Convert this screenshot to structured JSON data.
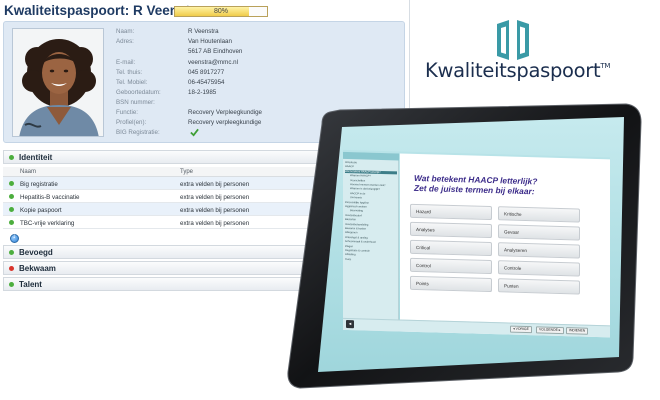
{
  "profile": {
    "title": "Kwaliteitspaspoort: R Veenstra",
    "progress_label": "80%",
    "progress_value": 0.8,
    "fields": [
      {
        "label": "Naam:",
        "value": "R Veenstra"
      },
      {
        "label": "Adres:",
        "value": "Van Houtenlaan"
      },
      {
        "label": "",
        "value": "5617 AB Eindhoven"
      },
      {
        "label": "E-mail:",
        "value": "veenstra@mmc.nl"
      },
      {
        "label": "Tel. thuis:",
        "value": "045 8917277"
      },
      {
        "label": "Tel. Mobiel:",
        "value": "06-45475954"
      },
      {
        "label": "Geboortedatum:",
        "value": "18-2-1985"
      },
      {
        "label": "BSN nummer:",
        "value": ""
      },
      {
        "label": "Functie:",
        "value": "Recovery Verpleegkundige"
      },
      {
        "label": "Profiel(en):",
        "value": "Recovery verpleegkundige"
      },
      {
        "label": "BIG Registratie:",
        "value": ""
      }
    ],
    "big_check_icon": "check-icon",
    "sections": {
      "identiteit": "Identiteit",
      "bevoegd": "Bevoegd",
      "bekwaam": "Bekwaam",
      "talent": "Talent"
    },
    "table": {
      "headers": [
        "Naam",
        "Type"
      ],
      "rows": [
        {
          "name": "Big registratie",
          "type": "extra velden bij personen"
        },
        {
          "name": "Hepatitis-B vaccinatie",
          "type": "extra velden bij personen"
        },
        {
          "name": "Kopie paspoort",
          "type": "extra velden bij personen"
        },
        {
          "name": "TBC-vrije verklaring",
          "type": "extra velden bij personen"
        }
      ]
    },
    "colors": {
      "green": "#4cae3e",
      "red": "#d9342b",
      "title": "#1f3b63"
    }
  },
  "logo": {
    "text": "Kwaliteitspaspoort",
    "tm": "TM",
    "color": "#1b2e4e",
    "accent": "#3a9aa6"
  },
  "tablet": {
    "topbar_left": "HAACP",
    "topbar_right": "Voortgang",
    "sidebar_items": [
      {
        "label": "Introductie"
      },
      {
        "label": "HAACP"
      },
      {
        "label": "Wat betekent HAACP letterlijk?",
        "active": true
      },
      {
        "label": "Waarom HAACP?",
        "sub": true
      },
      {
        "label": "Voorschriften",
        "sub": true
      },
      {
        "label": "Hoeveel mensen werden ziek?",
        "sub": true
      },
      {
        "label": "Waarom is dat belangrijk?",
        "sub": true
      },
      {
        "label": "HACCP in de",
        "sub": true
      },
      {
        "label": "Uw kennis",
        "sub": true
      },
      {
        "label": "Persoonlijke hygiëne"
      },
      {
        "label": "Hygiënisch werken"
      },
      {
        "label": "Besmetting",
        "sub": true
      },
      {
        "label": "Voedselbederf"
      },
      {
        "label": "Bacteriën"
      },
      {
        "label": "Voedselbehandeling"
      },
      {
        "label": "Bewaren & koelen"
      },
      {
        "label": "Allergenen"
      },
      {
        "label": "Ontvangst & opslag"
      },
      {
        "label": "Schoonmaak & onderhoud"
      },
      {
        "label": "Plagen"
      },
      {
        "label": "Registratie & controle"
      },
      {
        "label": "Afsluiting"
      },
      {
        "label": "Toets"
      }
    ],
    "question": [
      "Wat betekent HAACP letterlijk?",
      "Zet de juiste termen bij elkaar:"
    ],
    "left_terms": [
      "Hazard",
      "Analyses",
      "Critical",
      "Control",
      "Points"
    ],
    "right_terms": [
      "Kritische",
      "Gevaar",
      "Analyseren",
      "Controle",
      "Punten"
    ],
    "nav": {
      "prev": "◂ VORIGE",
      "next": "VOLGENDE ▸",
      "submit": "INDIENEN"
    }
  }
}
